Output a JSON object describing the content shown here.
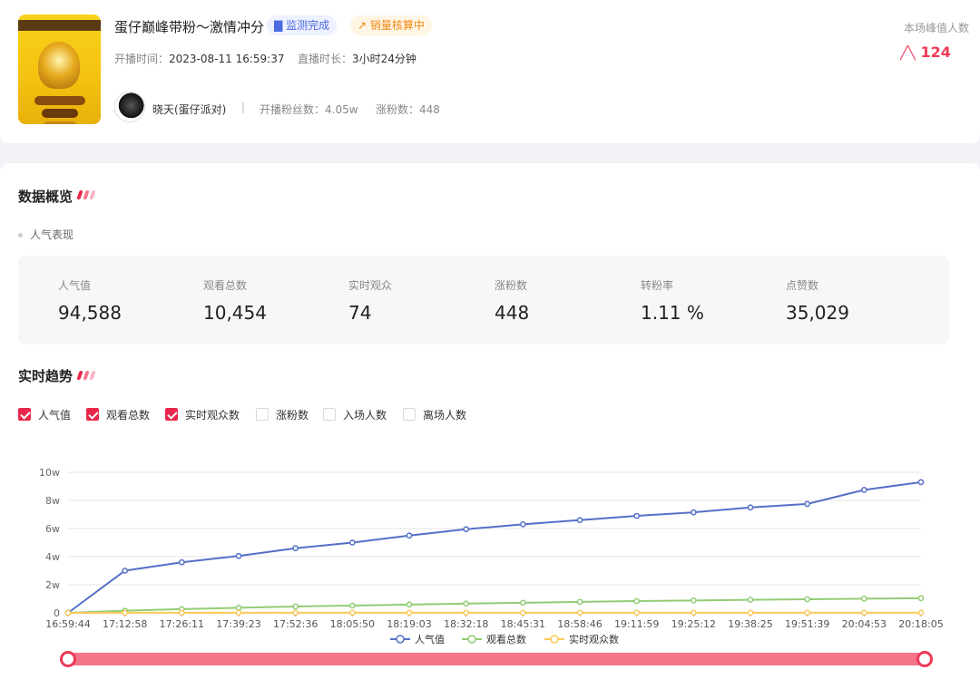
{
  "stream": {
    "title": "蛋仔巅峰带粉～激情冲分",
    "tag_monitor": "监测完成",
    "tag_sales": "销量核算中",
    "start_label": "开播时间：",
    "start_time": "2023-08-11 16:59:37",
    "duration_label": "直播时长：",
    "duration": "3小时24分钟",
    "anchor_name": "晓天(蛋仔派对)",
    "separator": "|",
    "fans_label": "开播粉丝数：",
    "fans_value": "4.05w",
    "gain_label": "涨粉数：",
    "gain_value": "448",
    "peak_label": "本场峰值人数",
    "peak_value": "124",
    "cover_icon": "egg-party-rank-badge"
  },
  "overview": {
    "title": "数据概览",
    "subtitle": "人气表现",
    "metrics": [
      {
        "label": "人气值",
        "value": "94,588"
      },
      {
        "label": "观看总数",
        "value": "10,454"
      },
      {
        "label": "实时观众",
        "value": "74"
      },
      {
        "label": "涨粉数",
        "value": "448"
      },
      {
        "label": "转粉率",
        "value": "1.11 %"
      },
      {
        "label": "点赞数",
        "value": "35,029"
      }
    ]
  },
  "trend": {
    "title": "实时趋势",
    "toggles": [
      {
        "label": "人气值",
        "checked": true
      },
      {
        "label": "观看总数",
        "checked": true
      },
      {
        "label": "实时观众数",
        "checked": true
      },
      {
        "label": "涨粉数",
        "checked": false
      },
      {
        "label": "入场人数",
        "checked": false
      },
      {
        "label": "离场人数",
        "checked": false
      }
    ]
  },
  "colors": {
    "accent": "#e8274b",
    "peak": "#ee3b57",
    "series_popularity": "#5470c6",
    "series_views": "#91cc75",
    "series_viewers": "#fac858",
    "mark1": "#e8274b",
    "mark2": "#f47488",
    "mark3": "#f8b4c0"
  },
  "chart_data": {
    "type": "line",
    "x": [
      "16:59:44",
      "17:12:58",
      "17:26:11",
      "17:39:23",
      "17:52:36",
      "18:05:50",
      "18:19:03",
      "18:32:18",
      "18:45:31",
      "18:58:46",
      "19:11:59",
      "19:25:12",
      "19:38:25",
      "19:51:39",
      "20:04:53",
      "20:18:05"
    ],
    "xlabel": "",
    "ylabel": "",
    "ylim": [
      0,
      100000
    ],
    "yticks": [
      "0",
      "2w",
      "4w",
      "6w",
      "8w",
      "10w"
    ],
    "grid": true,
    "legend": "bottom",
    "series": [
      {
        "name": "人气值",
        "values": [
          0,
          30000,
          36000,
          40500,
          46000,
          50000,
          55000,
          59500,
          63000,
          66000,
          69000,
          71500,
          75000,
          77500,
          87500,
          93000
        ]
      },
      {
        "name": "观看总数",
        "values": [
          0,
          1500,
          2700,
          3600,
          4500,
          5200,
          5900,
          6600,
          7200,
          7800,
          8400,
          8800,
          9300,
          9700,
          10100,
          10400
        ]
      },
      {
        "name": "实时观众数",
        "values": [
          0,
          80,
          90,
          85,
          80,
          78,
          82,
          80,
          76,
          75,
          78,
          74,
          76,
          72,
          75,
          74
        ]
      }
    ]
  }
}
